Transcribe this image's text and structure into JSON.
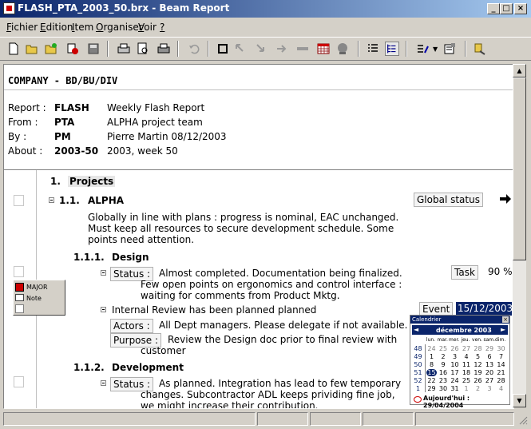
{
  "window": {
    "title": "FLASH_PTA_2003_50.brx - Beam Report"
  },
  "menu": [
    {
      "pre": "",
      "key": "F",
      "post": "ichier"
    },
    {
      "pre": "",
      "key": "E",
      "post": "dition"
    },
    {
      "pre": "",
      "key": "I",
      "post": "tem"
    },
    {
      "pre": "",
      "key": "O",
      "post": "rganiser"
    },
    {
      "pre": "",
      "key": "V",
      "post": "oir"
    },
    {
      "pre": "",
      "key": "?",
      "post": ""
    }
  ],
  "header": {
    "company": "COMPANY - BD/BU/DIV",
    "rows": [
      {
        "label": "Report :",
        "code": "FLASH",
        "desc": "Weekly Flash Report"
      },
      {
        "label": "From :",
        "code": "PTA",
        "desc": "ALPHA project team"
      },
      {
        "label": "By :",
        "code": "PM",
        "desc": "Pierre Martin  08/12/2003"
      },
      {
        "label": "About :",
        "code": "2003-50",
        "desc": "2003, week 50"
      }
    ]
  },
  "content": {
    "s1_num": "1.",
    "s1_title": "Projects",
    "s11_num": "1.1.",
    "s11_title": "ALPHA",
    "global_status": "Global status",
    "s11_text": [
      "Globally in line with plans : progress is nominal, EAC unchanged.",
      "Must keep all resources to secure development schedule. Some",
      "points need attention."
    ],
    "s111_num": "1.1.1.",
    "s111_title": "Design",
    "status_label": "Status :",
    "s111_status": [
      "Almost completed. Documentation being finalized.",
      "Few open points on ergonomics and control interface :",
      "waiting for comments from Product Mktg."
    ],
    "task_label": "Task",
    "task_value": "90 %",
    "review_text": "Internal Review has been planned planned",
    "event_label": "Event",
    "event_value": "15/12/2003",
    "actors_label": "Actors :",
    "actors_text": "All Dept managers. Please delegate if not available.",
    "purpose_label": "Purpose :",
    "purpose_text": [
      "Review the Design doc prior to final review with",
      "customer"
    ],
    "s112_num": "1.1.2.",
    "s112_title": "Development",
    "s112_status": [
      "As planned. Integration has lead to few temporary",
      "changes. Subcontractor ADL keeps prividing fine job,",
      "we might increase their contribution."
    ]
  },
  "popup": {
    "items": [
      "MAJOR",
      "Note"
    ]
  },
  "calendar": {
    "title": "Calendrier",
    "month": "décembre 2003",
    "days": [
      "lun.",
      "mar.",
      "mer.",
      "jeu.",
      "ven.",
      "sam.",
      "dim."
    ],
    "weeks": [
      "48",
      "49",
      "50",
      "51",
      "52",
      "1"
    ],
    "rows": [
      [
        "24",
        "25",
        "26",
        "27",
        "28",
        "29",
        "30"
      ],
      [
        "1",
        "2",
        "3",
        "4",
        "5",
        "6",
        "7"
      ],
      [
        "8",
        "9",
        "10",
        "11",
        "12",
        "13",
        "14"
      ],
      [
        "15",
        "16",
        "17",
        "18",
        "19",
        "20",
        "21"
      ],
      [
        "22",
        "23",
        "24",
        "25",
        "26",
        "27",
        "28"
      ],
      [
        "29",
        "30",
        "31",
        "1",
        "2",
        "3",
        "4"
      ]
    ],
    "today": "Aujourd'hui : 29/04/2004",
    "accent": "#0a246a"
  }
}
